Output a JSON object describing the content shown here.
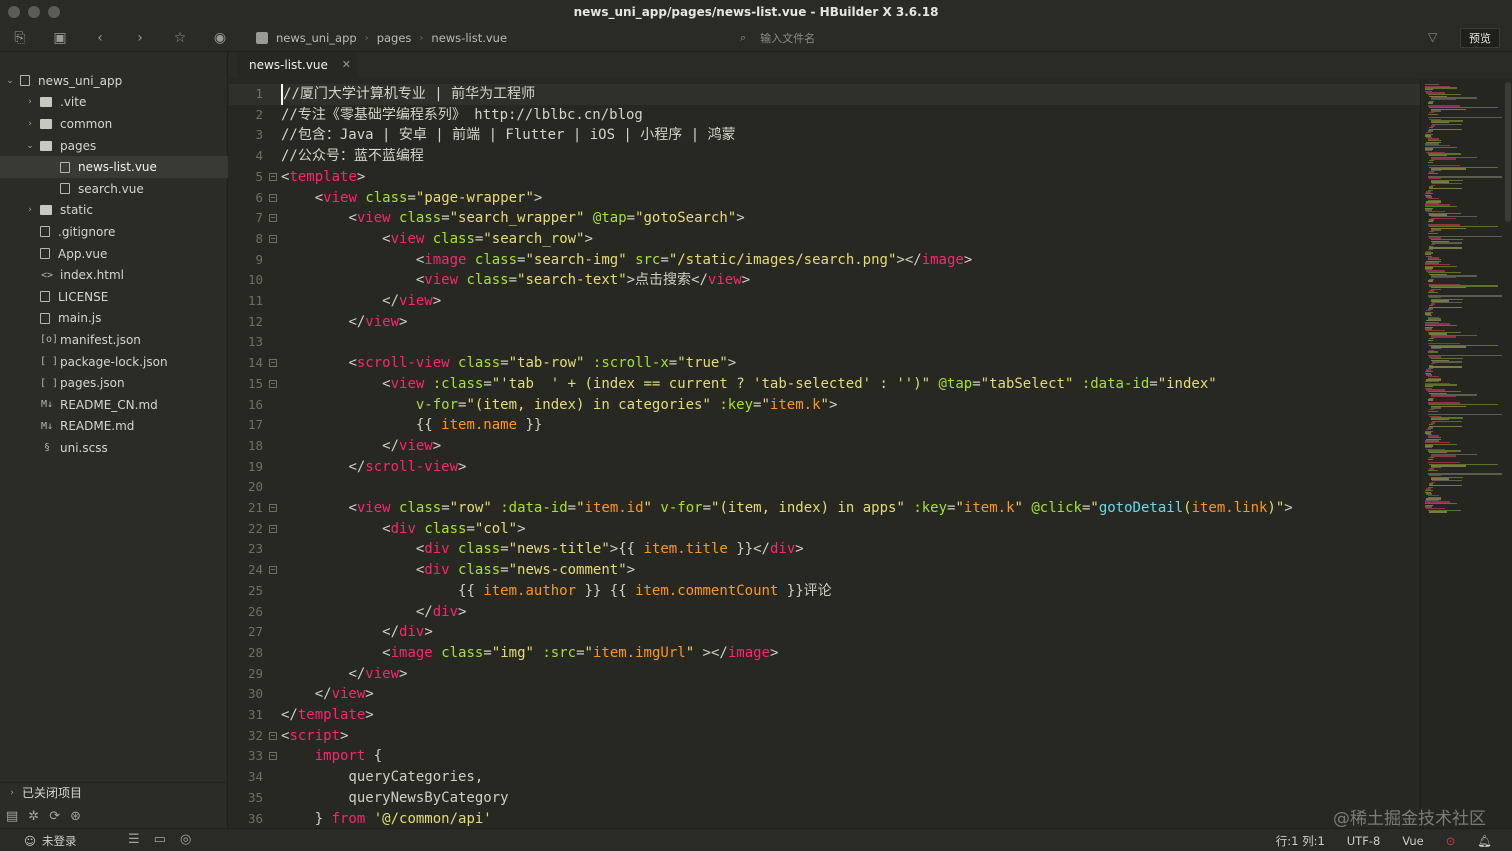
{
  "window": {
    "title": "news_uni_app/pages/news-list.vue - HBuilder X 3.6.18"
  },
  "toolbar": {
    "breadcrumbs": [
      "news_uni_app",
      "pages",
      "news-list.vue"
    ],
    "search_placeholder": "输入文件名",
    "preview_label": "预览"
  },
  "sidebar": {
    "items": [
      {
        "label": "news_uni_app",
        "type": "project",
        "expanded": true
      },
      {
        "label": ".vite",
        "type": "folder"
      },
      {
        "label": "common",
        "type": "folder"
      },
      {
        "label": "pages",
        "type": "folder",
        "expanded": true
      },
      {
        "label": "news-list.vue",
        "type": "vue",
        "selected": true
      },
      {
        "label": "search.vue",
        "type": "vue"
      },
      {
        "label": "static",
        "type": "folder"
      },
      {
        "label": ".gitignore",
        "type": "file"
      },
      {
        "label": "App.vue",
        "type": "file"
      },
      {
        "label": "index.html",
        "type": "html"
      },
      {
        "label": "LICENSE",
        "type": "file"
      },
      {
        "label": "main.js",
        "type": "js"
      },
      {
        "label": "manifest.json",
        "type": "manifest"
      },
      {
        "label": "package-lock.json",
        "type": "json"
      },
      {
        "label": "pages.json",
        "type": "json"
      },
      {
        "label": "README_CN.md",
        "type": "md"
      },
      {
        "label": "README.md",
        "type": "md"
      },
      {
        "label": "uni.scss",
        "type": "scss"
      }
    ],
    "closed_projects_label": "已关闭项目"
  },
  "tab": {
    "label": "news-list.vue"
  },
  "code": {
    "lines": [
      "//厦门大学计算机专业 | 前华为工程师",
      "//专注《零基础学编程系列》 http://lblbc.cn/blog",
      "//包含：Java | 安卓 | 前端 | Flutter | iOS | 小程序 | 鸿蒙",
      "//公众号：蓝不蓝编程",
      "<template>",
      "    <view class=\"page-wrapper\">",
      "        <view class=\"search_wrapper\" @tap=\"gotoSearch\">",
      "            <view class=\"search_row\">",
      "                <image class=\"search-img\" src=\"/static/images/search.png\"></image>",
      "                <view class=\"search-text\">点击搜索</view>",
      "            </view>",
      "        </view>",
      "",
      "        <scroll-view class=\"tab-row\" :scroll-x=\"true\">",
      "            <view :class=\"'tab  ' + (index == current ? 'tab-selected' : '')\" @tap=\"tabSelect\" :data-id=\"index\"",
      "                v-for=\"(item, index) in categories\" :key=\"item.k\">",
      "                {{ item.name }}",
      "            </view>",
      "        </scroll-view>",
      "",
      "        <view class=\"row\" :data-id=\"item.id\" v-for=\"(item, index) in apps\" :key=\"item.k\" @click=\"gotoDetail(item.link)\">",
      "            <div class=\"col\">",
      "                <div class=\"news-title\">{{ item.title }}</div>",
      "                <div class=\"news-comment\">",
      "                     {{ item.author }} {{ item.commentCount }}评论",
      "                </div>",
      "            </div>",
      "            <image class=\"img\" :src=\"item.imgUrl\" ></image>",
      "        </view>",
      "    </view>",
      "</template>",
      "<script>",
      "    import {",
      "        queryCategories,",
      "        queryNewsByCategory",
      "    } from '@/common/api'"
    ],
    "line_numbers": [
      "1",
      "2",
      "3",
      "4",
      "5",
      "6",
      "7",
      "8",
      "9",
      "10",
      "11",
      "12",
      "13",
      "14",
      "15",
      "16",
      "17",
      "18",
      "19",
      "20",
      "21",
      "22",
      "23",
      "24",
      "25",
      "26",
      "27",
      "28",
      "29",
      "30",
      "31",
      "32",
      "33",
      "34",
      "35",
      "36"
    ],
    "current_line": 1
  },
  "watermark": "@稀土掘金技术社区",
  "statusbar": {
    "user_label": "未登录",
    "position": "行:1  列:1",
    "encoding": "UTF-8",
    "language": "Vue"
  },
  "colors": {
    "background": "#272822",
    "sidebar": "#2b2b27",
    "tag": "#f92672",
    "attribute": "#a6e22e",
    "string": "#e6db74",
    "function": "#66d9ef",
    "variable": "#fd971f"
  }
}
